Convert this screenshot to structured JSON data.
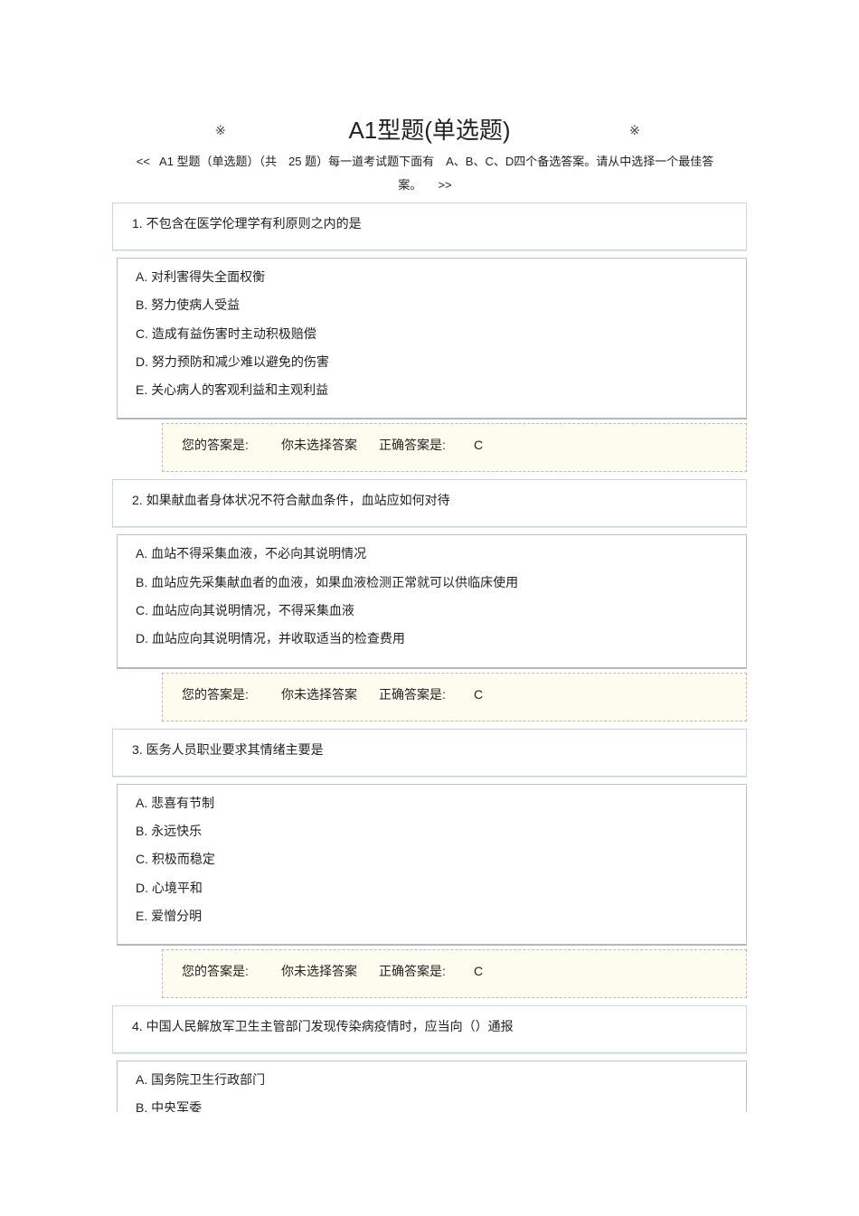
{
  "header": {
    "mark": "※",
    "title": "A1型题(单选题)",
    "prev": "<<",
    "intro": "A1 型题（单选题）（共　25 题）每一道考试题下面有　A、B、C、D四个备选答案。请从中选择一个最佳答案。",
    "next": ">>"
  },
  "answer_labels": {
    "your_answer": "您的答案是:",
    "not_selected": "你未选择答案",
    "correct": "正确答案是:"
  },
  "questions": [
    {
      "text": "1. 不包含在医学伦理学有利原则之内的是",
      "options": [
        "A. 对利害得失全面权衡",
        "B. 努力使病人受益",
        "C. 造成有益伤害时主动积极赔偿",
        "D. 努力预防和减少难以避免的伤害",
        "E. 关心病人的客观利益和主观利益"
      ],
      "answer": "C"
    },
    {
      "text": "2. 如果献血者身体状况不符合献血条件，血站应如何对待",
      "options": [
        "A. 血站不得采集血液，不必向其说明情况",
        "B. 血站应先采集献血者的血液，如果血液检测正常就可以供临床使用",
        "C. 血站应向其说明情况，不得采集血液",
        "D. 血站应向其说明情况，并收取适当的检查费用"
      ],
      "answer": "C"
    },
    {
      "text": "3. 医务人员职业要求其情绪主要是",
      "options": [
        "A. 悲喜有节制",
        "B. 永远快乐",
        "C. 积极而稳定",
        "D. 心境平和",
        "E. 爱憎分明"
      ],
      "answer": "C"
    },
    {
      "text": "4. 中国人民解放军卫生主管部门发现传染病疫情时，应当向（）通报",
      "options": [
        "A. 国务院卫生行政部门",
        "B. 中央军委"
      ]
    }
  ]
}
